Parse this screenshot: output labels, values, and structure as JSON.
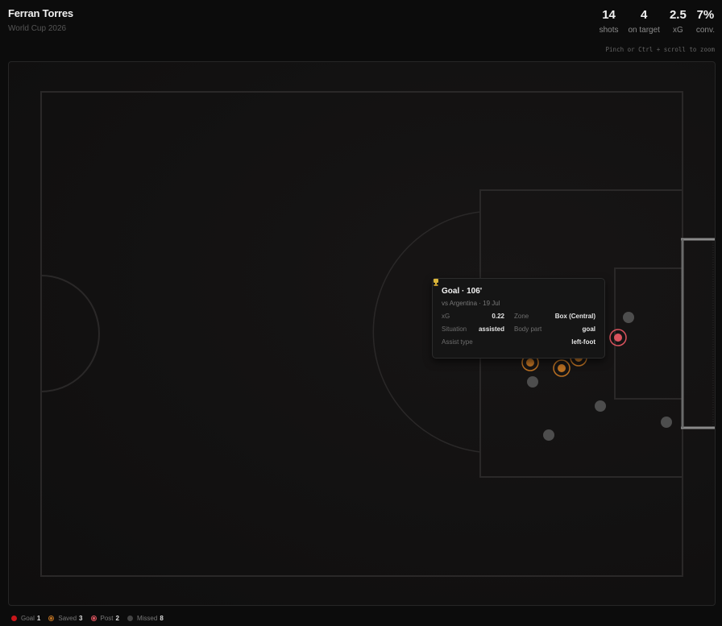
{
  "header": {
    "player_name": "Ferran Torres",
    "competition": "World Cup 2026"
  },
  "stats": [
    {
      "value": "14",
      "label": "shots"
    },
    {
      "value": "4",
      "label": "on target"
    },
    {
      "value": "2.5",
      "label": "xG"
    },
    {
      "value": "7%",
      "label": "conv."
    }
  ],
  "zoom_hint": "Pinch or Ctrl + scroll to zoom",
  "colors": {
    "goal": "#c8161a",
    "saved": "#b86f22",
    "post": "#d9535e",
    "missed": "#555555"
  },
  "shots": [
    {
      "outcome": "goal",
      "selected": true
    },
    {
      "outcome": "post"
    },
    {
      "outcome": "post"
    },
    {
      "outcome": "saved"
    },
    {
      "outcome": "saved"
    },
    {
      "outcome": "saved"
    },
    {
      "outcome": "missed"
    },
    {
      "outcome": "missed"
    },
    {
      "outcome": "missed"
    },
    {
      "outcome": "missed"
    },
    {
      "outcome": "missed"
    },
    {
      "outcome": "missed"
    },
    {
      "outcome": "missed"
    },
    {
      "outcome": "missed"
    }
  ],
  "tooltip": {
    "title": "Goal · 106'",
    "icon": "trophy-icon",
    "subtitle": "vs Argentina · 19 Jul",
    "xg_label": "xG",
    "xg_value": "0.22",
    "zone_label": "Zone",
    "zone_value": "Box (Central)",
    "situation_label": "Situation",
    "situation_value": "assisted",
    "body_part_label": "Body part",
    "body_part_value": "goal",
    "assist_type_label": "Assist type",
    "assist_type_value": "left-foot"
  },
  "legend": [
    {
      "key": "goal",
      "label": "Goal",
      "count": "1"
    },
    {
      "key": "saved",
      "label": "Saved",
      "count": "3"
    },
    {
      "key": "post",
      "label": "Post",
      "count": "2"
    },
    {
      "key": "missed",
      "label": "Missed",
      "count": "8"
    }
  ]
}
